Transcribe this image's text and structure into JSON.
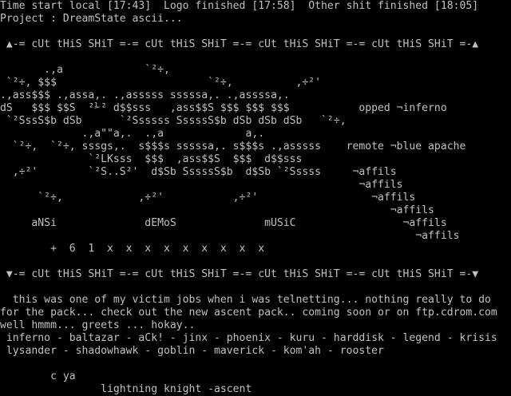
{
  "terminal": {
    "colors": {
      "background": "#000000",
      "foreground": "#c0c0c0"
    },
    "lines": [
      "Time start local [17:43]  Logo finished [17:58]  Other shit finished [18:05]",
      "Project : DreamState ascii...",
      "",
      " ▲-= cUt tHiS SHiT =-= cUt tHiS SHiT =-= cUt tHiS SHiT =-= cUt tHiS SHiT =-▲",
      "",
      "       .,a             `²÷,",
      " `²÷, $$$                        `²÷,          ,÷²'",
      ".,ass$$$ .,assa,. .,asssss sssssa,. .,assssa,.",
      "dS   $$$ $$S  ²⅟² d$$sss   ,ass$$S $$$ $$$ $$$           opped ¬inferno",
      " `²SssS$b dSb      `²Ssssss SssssS$b dSb dSb dSb   `²÷,",
      "             .,a\"\"a,.  .,a             a,.",
      "  `²÷,  `²÷, sssgs,.  s$$$s sssssa,. s$$$s .,asssss    remote ¬blue apache",
      "              `²LKsss  $$$  ,ass$$S  $$$  d$$sss",
      "  ,÷²'        `²S..S²'  d$Sb SssssS$b  d$Sb `²Sssss     ¬affils",
      "                                                         ¬affils",
      "      `²÷,            ,÷²'           ,÷²'                  ¬affils",
      "                                                              ¬affils",
      "     aNSi              dEMoS              mUSiC                 ¬affils",
      "                                                                  ¬affils",
      "        +  6  1  x  x  x  x  x  x  x  x  x",
      "",
      " ▼-= cUt tHiS SHiT =-= cUt tHiS SHiT =-= cUt tHiS SHiT =-= cUt tHiS SHiT =-▼",
      "",
      "  this was one of my victim jobs when i was telnetting... nothing really to do",
      "for the pack... check out the new ascent pack.. coming soon or on ftp.cdrom.com",
      "well hmmm... greets ... hokay..",
      " inferno - baltazar - aCk! - jinx - phoenix - kuru - harddisk - legend - krisis",
      " lysander - shadowhawk - goblin - maverick - kom'ah - rooster",
      "",
      "        c ya",
      "                lightning knight -ascent"
    ]
  }
}
